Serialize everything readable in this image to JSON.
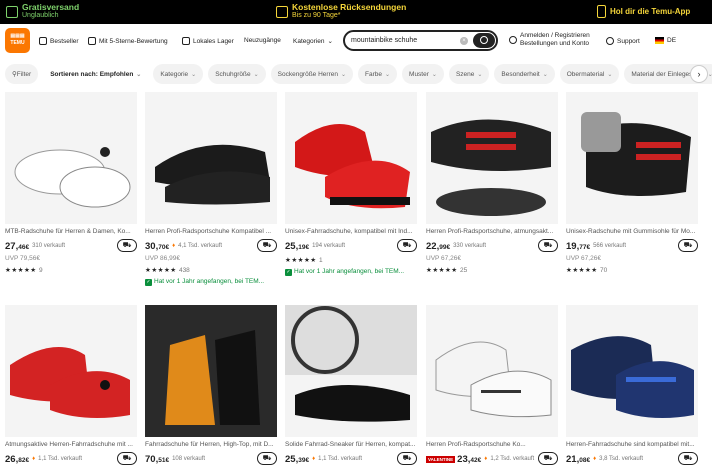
{
  "topbar": {
    "shipping_title": "Gratisversand",
    "shipping_sub": "Unglaublich",
    "returns_title": "Kostenlose Rücksendungen",
    "returns_sub": "Bis zu 90 Tage*",
    "app_label": "Hol dir die Temu-App"
  },
  "header": {
    "logo_text": "TEMU",
    "nav": [
      "Bestseller",
      "Mit 5-Sterne-Bewertung",
      "Lokales Lager",
      "Neuzugänge",
      "Kategorien"
    ],
    "search_value": "mountainbike schuhe",
    "account_line1": "Anmelden / Registrieren",
    "account_line2": "Bestellungen und Konto",
    "support": "Support",
    "lang": "DE"
  },
  "filters": [
    "Filter",
    "Sortieren nach: Empfohlen",
    "Kategorie",
    "Schuhgröße",
    "Sockengröße Herren",
    "Farbe",
    "Muster",
    "Szene",
    "Besonderheit",
    "Obermaterial",
    "Material der Einlegesohle"
  ],
  "products": [
    {
      "title": "MTB-Radschuhe für Herren & Damen, Ko...",
      "price_main": "27,",
      "price_cents": "46€",
      "sold": "310 verkauft",
      "uvp": "UVP 79,56€",
      "stars": "★★★★★",
      "reviews": "9",
      "badge": "",
      "hot": false,
      "flag": ""
    },
    {
      "title": "Herren Profi-Radsportschuhe Kompatibel ...",
      "price_main": "30,",
      "price_cents": "70€",
      "sold": "4,1 Tsd. verkauft",
      "uvp": "UVP 86,99€",
      "stars": "★★★★★",
      "reviews": "438",
      "badge": "Hat vor 1 Jahr angefangen, bei TEM...",
      "hot": true,
      "flag": ""
    },
    {
      "title": "Unisex-Fahrradschuhe, kompatibel mit Ind...",
      "price_main": "25,",
      "price_cents": "19€",
      "sold": "194 verkauft",
      "uvp": "",
      "stars": "★★★★★",
      "reviews": "1",
      "badge": "Hat vor 1 Jahr angefangen, bei TEM...",
      "hot": false,
      "flag": ""
    },
    {
      "title": "Herren Profi-Radsportschuhe, atmungsakt...",
      "price_main": "22,",
      "price_cents": "99€",
      "sold": "330 verkauft",
      "uvp": "UVP 67,26€",
      "stars": "★★★★★",
      "reviews": "25",
      "badge": "",
      "hot": false,
      "flag": ""
    },
    {
      "title": "Unisex-Radschuhe mit Gummisohle für Mo...",
      "price_main": "19,",
      "price_cents": "77€",
      "sold": "566 verkauft",
      "uvp": "UVP 67,26€",
      "stars": "★★★★★",
      "reviews": "70",
      "badge": "",
      "hot": false,
      "flag": ""
    },
    {
      "title": "Atmungsaktive Herren-Fahrradschuhe mit ...",
      "price_main": "26,",
      "price_cents": "82€",
      "sold": "1,1 Tsd. verkauft",
      "uvp": "",
      "stars": "",
      "reviews": "",
      "badge": "",
      "hot": true,
      "flag": ""
    },
    {
      "title": "Fahrradschuhe für Herren, High-Top, mit D...",
      "price_main": "70,",
      "price_cents": "51€",
      "sold": "108 verkauft",
      "uvp": "",
      "stars": "",
      "reviews": "",
      "badge": "",
      "hot": false,
      "flag": ""
    },
    {
      "title": "Solide Fahrrad-Sneaker für Herren, kompat...",
      "price_main": "25,",
      "price_cents": "39€",
      "sold": "1,1 Tsd. verkauft",
      "uvp": "",
      "stars": "",
      "reviews": "",
      "badge": "",
      "hot": true,
      "flag": ""
    },
    {
      "title": "Herren Profi-Radsportschuhe Ko...",
      "price_main": "23,",
      "price_cents": "42€",
      "sold": "1,2 Tsd. verkauft",
      "uvp": "",
      "stars": "",
      "reviews": "",
      "badge": "",
      "hot": true,
      "flag": "VALENTINE"
    },
    {
      "title": "Herren-Fahrradschuhe sind kompatibel mit...",
      "price_main": "21,",
      "price_cents": "08€",
      "sold": "3,8 Tsd. verkauft",
      "uvp": "",
      "stars": "",
      "reviews": "",
      "badge": "",
      "hot": true,
      "flag": ""
    }
  ]
}
